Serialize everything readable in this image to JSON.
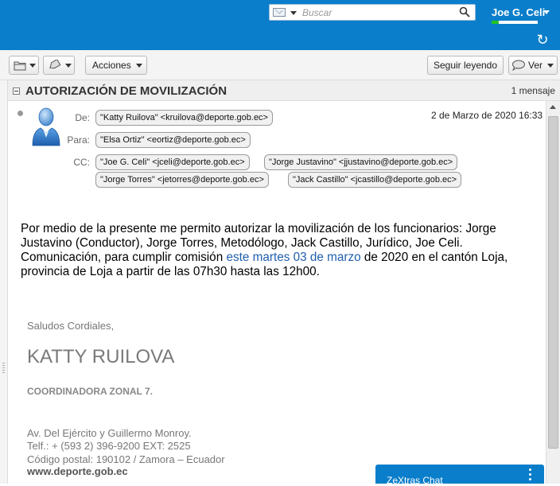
{
  "header": {
    "search_placeholder": "Buscar",
    "user_name": "Joe G. Celi"
  },
  "toolbar": {
    "actions_label": "Acciones",
    "keep_reading_label": "Seguir leyendo",
    "view_label": "Ver"
  },
  "conversation": {
    "subject": "AUTORIZACIÓN DE MOVILIZACIÓN",
    "count": "1 mensaje"
  },
  "message": {
    "from_label": "De:",
    "to_label": "Para:",
    "cc_label": "CC:",
    "from": "\"Katty Ruilova\" <kruilova@deporte.gob.ec>",
    "to": "\"Elsa Ortiz\" <eortiz@deporte.gob.ec>",
    "cc": [
      "\"Joe G. Celi\" <jceli@deporte.gob.ec>",
      "\"Jorge Justavino\" <jjustavino@deporte.gob.ec>",
      "\"Jorge Torres\" <jetorres@deporte.gob.ec>",
      "\"Jack Castillo\" <jcastillo@deporte.gob.ec>"
    ],
    "date": "2 de Marzo de 2020 16:33",
    "body_part1": "Por medio de la presente me permito autorizar la movilización de los funcionarios: Jorge Justavino (Conductor), Jorge Torres, Metodólogo, Jack Castillo, Jurídico, Joe Celi. Comunicación, para cumplir comisión ",
    "body_link": "este martes 03 de marzo",
    "body_part2": " de 2020 en el cantón Loja, provincia de Loja a partir de las 07h30 hasta las 12h00."
  },
  "signature": {
    "greeting": "Saludos Cordiales,",
    "name": "KATTY RUILOVA",
    "role": "COORDINADORA ZONAL 7.",
    "address": "Av. Del Ejército y Guillermo Monroy.",
    "phone": "Telf.: + (593 2) 396-9200 EXT: 2525",
    "postal": "Código postal: 190102 / Zamora – Ecuador",
    "website": "www.deporte.gob.ec"
  },
  "chat": {
    "label": "ZeXtras Chat"
  },
  "colors": {
    "brand": "#0b7ecb",
    "link": "#1f5eae",
    "presence_online": "#24c424"
  }
}
